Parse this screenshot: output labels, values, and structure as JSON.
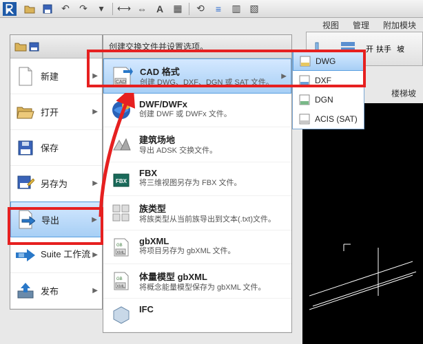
{
  "toolbar": {
    "title": "A"
  },
  "ribbon": {
    "tabs": [
      "视图",
      "管理",
      "附加模块"
    ],
    "handrail": "扶手",
    "slope": "坡",
    "handrail_open": "开",
    "stair_slope": "楼梯坡"
  },
  "app_menu": {
    "items": [
      {
        "label": "新建"
      },
      {
        "label": "打开"
      },
      {
        "label": "保存"
      },
      {
        "label": "另存为"
      },
      {
        "label": "导出"
      },
      {
        "label": "Suite 工作流"
      },
      {
        "label": "发布"
      }
    ]
  },
  "submenu": {
    "header": "创建交换文件并设置选项。",
    "items": [
      {
        "title": "CAD 格式",
        "desc": "创建 DWG、DXF、DGN 或 SAT 文件。",
        "has_arrow": true
      },
      {
        "title": "DWF/DWFx",
        "desc": "创建 DWF 或 DWFx 文件。"
      },
      {
        "title": "建筑场地",
        "desc": "导出 ADSK 交换文件。"
      },
      {
        "title": "FBX",
        "desc": "将三维视图另存为 FBX 文件。"
      },
      {
        "title": "族类型",
        "desc": "将族类型从当前族导出到文本(.txt)文件。"
      },
      {
        "title": "gbXML",
        "desc": "将项目另存为 gbXML 文件。"
      },
      {
        "title": "体量模型 gbXML",
        "desc": "将概念能量模型保存为 gbXML 文件。"
      },
      {
        "title": "IFC",
        "desc": ""
      }
    ]
  },
  "flyout": {
    "items": [
      {
        "label": "DWG"
      },
      {
        "label": "DXF"
      },
      {
        "label": "DGN"
      },
      {
        "label": "ACIS (SAT)"
      }
    ]
  }
}
